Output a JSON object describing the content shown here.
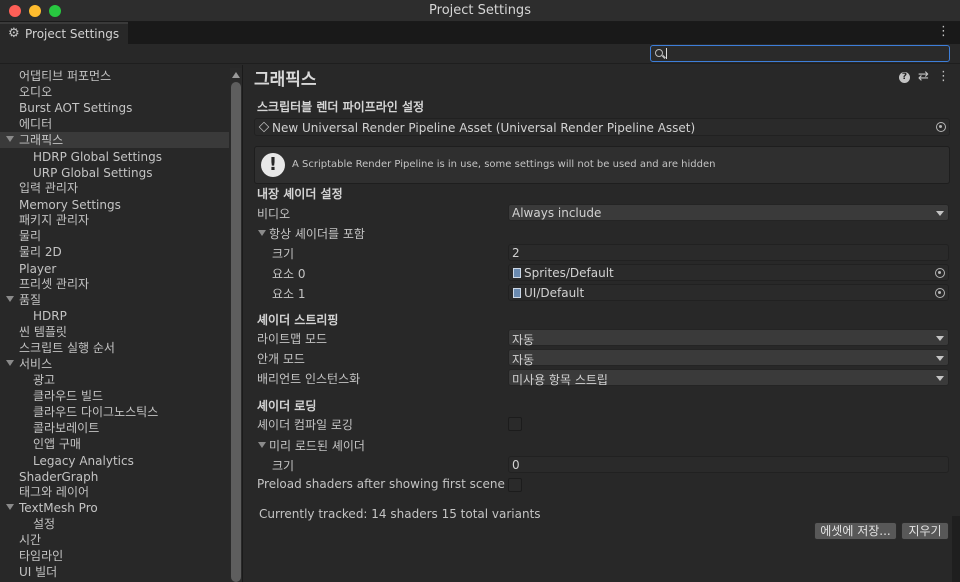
{
  "window": {
    "title": "Project Settings"
  },
  "tab": {
    "label": "Project Settings",
    "icon": "gear-icon"
  },
  "search": {
    "value": "",
    "placeholder": ""
  },
  "sidebar": {
    "items": [
      {
        "label": "어댑티브 퍼포먼스"
      },
      {
        "label": "오디오"
      },
      {
        "label": "Burst AOT Settings"
      },
      {
        "label": "에디터"
      },
      {
        "label": "그래픽스"
      },
      {
        "label": "HDRP Global Settings"
      },
      {
        "label": "URP Global Settings"
      },
      {
        "label": "입력 관리자"
      },
      {
        "label": "Memory Settings"
      },
      {
        "label": "패키지 관리자"
      },
      {
        "label": "물리"
      },
      {
        "label": "물리 2D"
      },
      {
        "label": "Player"
      },
      {
        "label": "프리셋 관리자"
      },
      {
        "label": "품질"
      },
      {
        "label": "HDRP"
      },
      {
        "label": "씬 템플릿"
      },
      {
        "label": "스크립트 실행 순서"
      },
      {
        "label": "서비스"
      },
      {
        "label": "광고"
      },
      {
        "label": "클라우드 빌드"
      },
      {
        "label": "클라우드 다이그노스틱스"
      },
      {
        "label": "콜라보레이트"
      },
      {
        "label": "인앱 구매"
      },
      {
        "label": "Legacy Analytics"
      },
      {
        "label": "ShaderGraph"
      },
      {
        "label": "태그와 레이어"
      },
      {
        "label": "TextMesh Pro"
      },
      {
        "label": "설정"
      },
      {
        "label": "시간"
      },
      {
        "label": "타임라인"
      },
      {
        "label": "UI 빌더"
      }
    ]
  },
  "main": {
    "title": "그래픽스",
    "srp_section": "스크립터블 렌더 파이프라인 설정",
    "srp_asset": "New Universal Render Pipeline Asset (Universal Render Pipeline Asset)",
    "help_text": "A Scriptable Render Pipeline is in use, some settings will not be used and are hidden",
    "builtin_section": "내장 셰이더 설정",
    "video_label": "비디오",
    "video_value": "Always include",
    "always_include_label": "항상 셰이더를 포함",
    "size_label": "크기",
    "size_value": "2",
    "element0_label": "요소 0",
    "element0_value": "Sprites/Default",
    "element1_label": "요소 1",
    "element1_value": "UI/Default",
    "stripping_section": "셰이더 스트리핑",
    "lightmap_label": "라이트맵 모드",
    "lightmap_value": "자동",
    "fog_label": "안개 모드",
    "fog_value": "자동",
    "instancing_label": "배리언트 인스턴스화",
    "instancing_value": "미사용 항목 스트립",
    "loading_section": "셰이더 로딩",
    "log_compile_label": "셰이더 컴파일 로깅",
    "log_compile_checked": false,
    "preloaded_label": "미리 로드된 셰이더",
    "preloaded_size_label": "크기",
    "preloaded_size_value": "0",
    "preload_after_label": "Preload shaders after showing first scene",
    "preload_after_checked": false,
    "tracked_text": "Currently tracked: 14 shaders 15 total variants",
    "save_button": "에셋에 저장...",
    "clear_button": "지우기"
  },
  "colors": {
    "background": "#282828",
    "selected": "#3a3a3a",
    "accent": "#3d7ed9",
    "close": "#fe5f57",
    "minimize": "#febc2e",
    "maximize": "#28c840"
  }
}
